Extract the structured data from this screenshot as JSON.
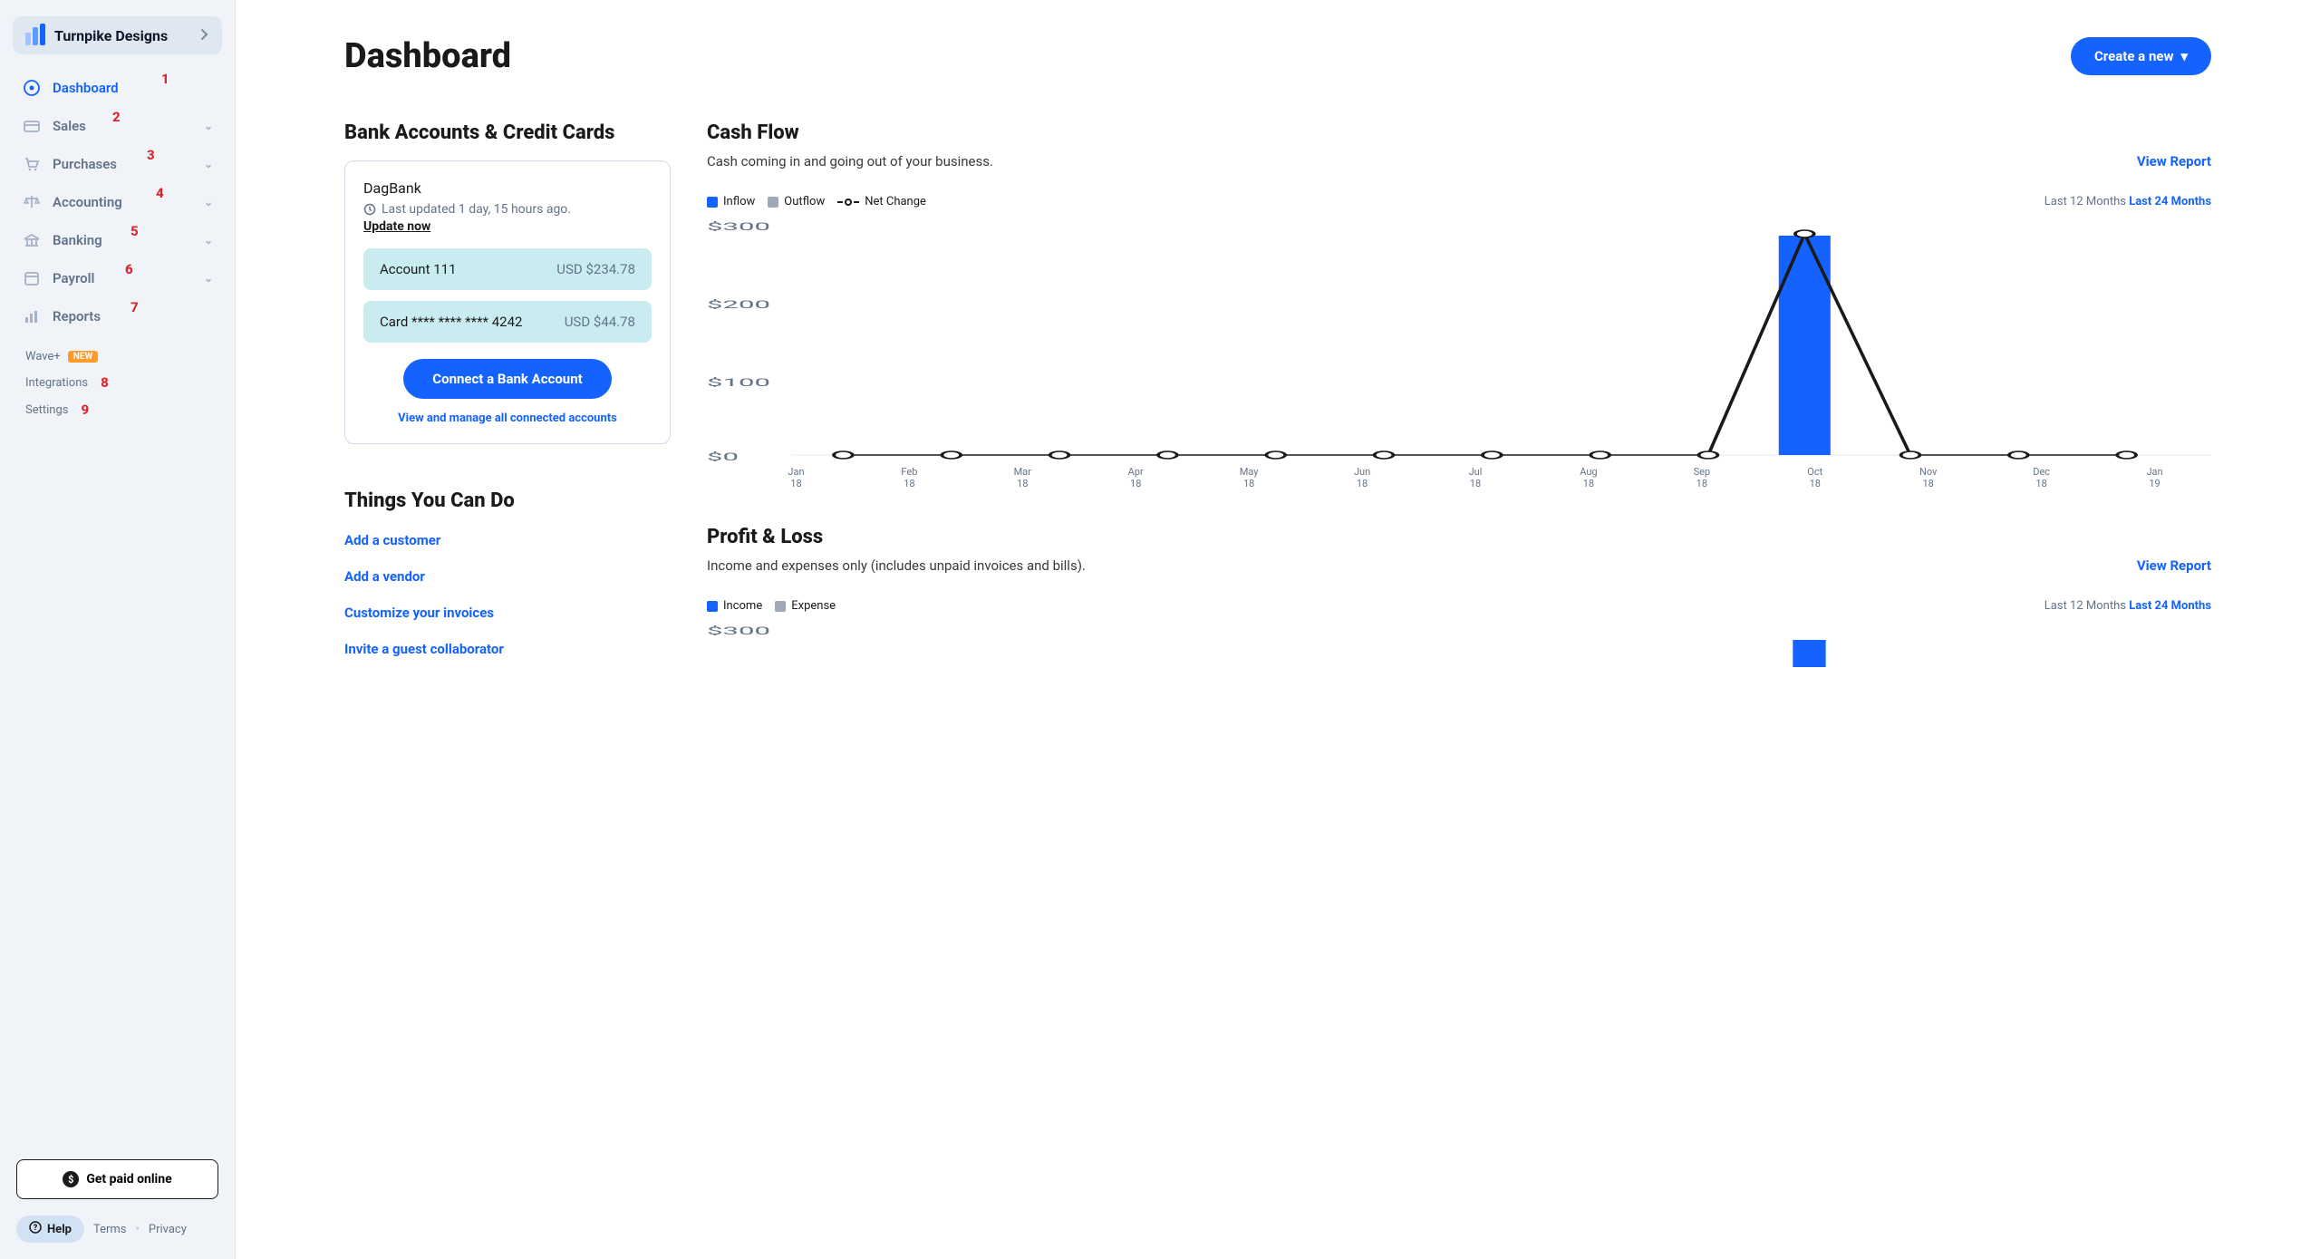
{
  "company": {
    "name": "Turnpike Designs"
  },
  "nav": {
    "dashboard": "Dashboard",
    "sales": "Sales",
    "purchases": "Purchases",
    "accounting": "Accounting",
    "banking": "Banking",
    "payroll": "Payroll",
    "reports": "Reports",
    "badges": {
      "dashboard": "1",
      "sales": "2",
      "purchases": "3",
      "accounting": "4",
      "banking": "5",
      "payroll": "6",
      "reports": "7",
      "integrations": "8",
      "settings": "9"
    }
  },
  "subnav": {
    "wave_plus": "Wave+",
    "wave_plus_badge": "NEW",
    "integrations": "Integrations",
    "settings": "Settings"
  },
  "sidebar_bottom": {
    "paid_online": "Get paid online",
    "help": "Help",
    "terms": "Terms",
    "privacy": "Privacy"
  },
  "header": {
    "title": "Dashboard",
    "create_btn": "Create a new"
  },
  "bank_section": {
    "title": "Bank Accounts & Credit Cards",
    "bank_name": "DagBank",
    "last_updated": "Last updated 1 day, 15 hours ago.",
    "update_now": "Update now",
    "accounts": [
      {
        "name": "Account 111",
        "amount": "USD $234.78"
      },
      {
        "name": "Card **** **** **** 4242",
        "amount": "USD $44.78"
      }
    ],
    "connect_btn": "Connect a Bank Account",
    "view_all": "View and manage all connected accounts"
  },
  "things_section": {
    "title": "Things You Can Do",
    "links": [
      "Add a customer",
      "Add a vendor",
      "Customize your invoices",
      "Invite a guest collaborator"
    ]
  },
  "cashflow": {
    "title": "Cash Flow",
    "subtitle": "Cash coming in and going out of your business.",
    "view_report": "View Report",
    "legend": {
      "inflow": "Inflow",
      "outflow": "Outflow",
      "net": "Net Change"
    },
    "timefilter": {
      "last12": "Last 12 Months",
      "last24": "Last 24 Months"
    }
  },
  "pl": {
    "title": "Profit & Loss",
    "subtitle": "Income and expenses only (includes unpaid invoices and bills).",
    "view_report": "View Report",
    "legend": {
      "income": "Income",
      "expense": "Expense"
    },
    "timefilter": {
      "last12": "Last 12 Months",
      "last24": "Last 24 Months"
    },
    "y_top": "$300"
  },
  "chart_data": {
    "type": "bar",
    "title": "Cash Flow",
    "xlabel": "",
    "ylabel": "",
    "ylim": [
      0,
      300
    ],
    "y_ticks": [
      "$300",
      "$200",
      "$100",
      "$0"
    ],
    "categories": [
      "Jan 18",
      "Feb 18",
      "Mar 18",
      "Apr 18",
      "May 18",
      "Jun 18",
      "Jul 18",
      "Aug 18",
      "Sep 18",
      "Oct 18",
      "Nov 18",
      "Dec 18",
      "Jan 19"
    ],
    "series": [
      {
        "name": "Inflow",
        "values": [
          0,
          0,
          0,
          0,
          0,
          0,
          0,
          0,
          0,
          280,
          0,
          0,
          0
        ]
      },
      {
        "name": "Outflow",
        "values": [
          0,
          0,
          0,
          0,
          0,
          0,
          0,
          0,
          0,
          0,
          0,
          0,
          0
        ]
      },
      {
        "name": "Net Change",
        "values": [
          0,
          0,
          0,
          0,
          0,
          0,
          0,
          0,
          0,
          280,
          0,
          0,
          0
        ]
      }
    ]
  }
}
